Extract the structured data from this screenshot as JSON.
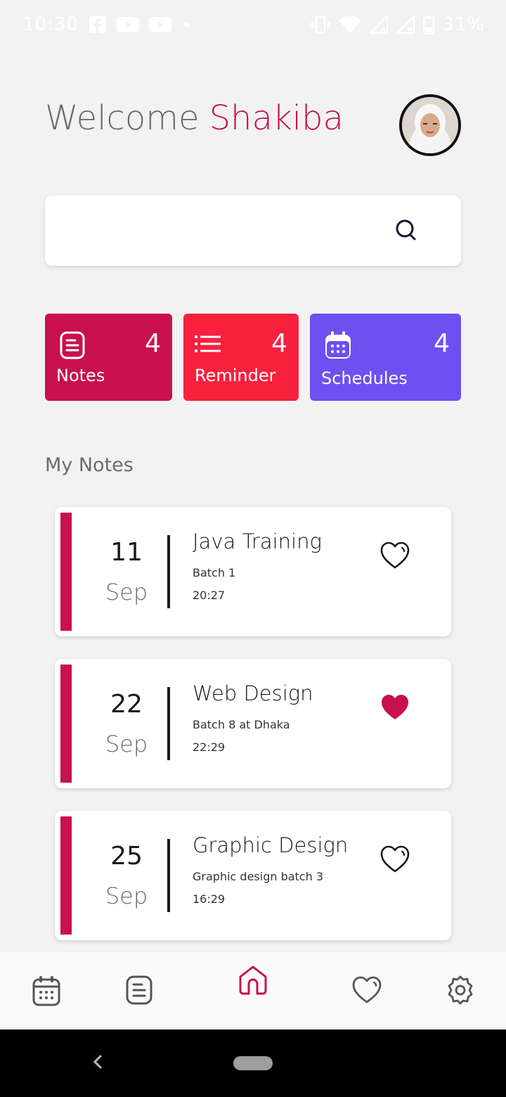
{
  "status_bar": {
    "time": "10:30",
    "battery": "31%",
    "left_icons": [
      "facebook-icon",
      "youtube-icon",
      "youtube-icon",
      "dot-icon"
    ],
    "right_icons": [
      "vibrate-icon",
      "wifi-icon",
      "signal-icon",
      "signal-icon",
      "battery-icon"
    ]
  },
  "header": {
    "welcome": "Welcome",
    "user_name": "Shakiba",
    "avatar_icon": "user-avatar"
  },
  "search": {
    "value": "",
    "icon": "search-icon"
  },
  "stats": [
    {
      "label": "Notes",
      "count": "4",
      "icon": "note-icon",
      "color": "#c8104f"
    },
    {
      "label": "Reminder",
      "count": "4",
      "icon": "list-icon",
      "color": "#f7213e"
    },
    {
      "label": "Schedules",
      "count": "4",
      "icon": "calendar-icon",
      "color": "#6e4ff2"
    }
  ],
  "section": {
    "title": "My Notes"
  },
  "notes": [
    {
      "day": "11",
      "month": "Sep",
      "title": "Java Training",
      "subtitle": "Batch 1",
      "time": "20:27",
      "favorite": false
    },
    {
      "day": "22",
      "month": "Sep",
      "title": "Web Design",
      "subtitle": "Batch 8 at Dhaka",
      "time": "22:29",
      "favorite": true
    },
    {
      "day": "25",
      "month": "Sep",
      "title": "Graphic Design",
      "subtitle": "Graphic design batch 3",
      "time": "16:29",
      "favorite": false
    }
  ],
  "bottom_nav": {
    "items": [
      "calendar-icon",
      "note-icon",
      "home-icon",
      "heart-icon",
      "settings-icon"
    ],
    "active": "home-icon"
  },
  "colors": {
    "brand": "#c8104f",
    "reminder": "#f7213e",
    "schedules": "#6e4ff2",
    "background": "#f2f2f2"
  }
}
